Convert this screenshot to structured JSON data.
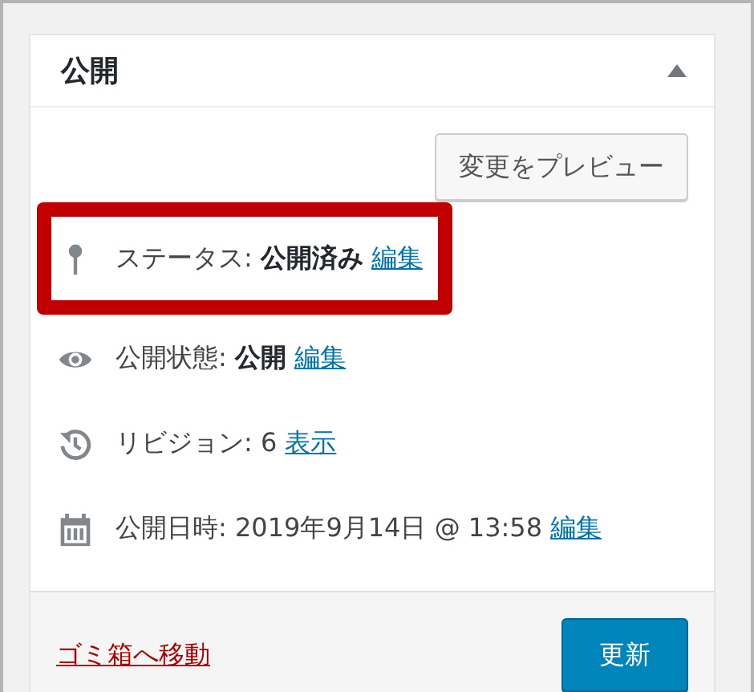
{
  "panel": {
    "title": "公開",
    "expanded": true
  },
  "preview_button": "変更をプレビュー",
  "rows": [
    {
      "kind": "pin",
      "text": "ステータス: **公開済み**",
      "link": "編集",
      "highlighted": true
    },
    {
      "kind": "eye",
      "text": "公開状態: **公開**",
      "link": "編集",
      "highlighted": false
    },
    {
      "kind": "history",
      "text": "リビジョン: 6",
      "link": "表示",
      "highlighted": false
    },
    {
      "kind": "calendar",
      "text": "公開日時: 2019年9月14日 @ 13:58",
      "link": "編集",
      "highlighted": false
    }
  ],
  "footer": {
    "trash_link": "ゴミ箱へ移動",
    "update_button": "更新"
  }
}
